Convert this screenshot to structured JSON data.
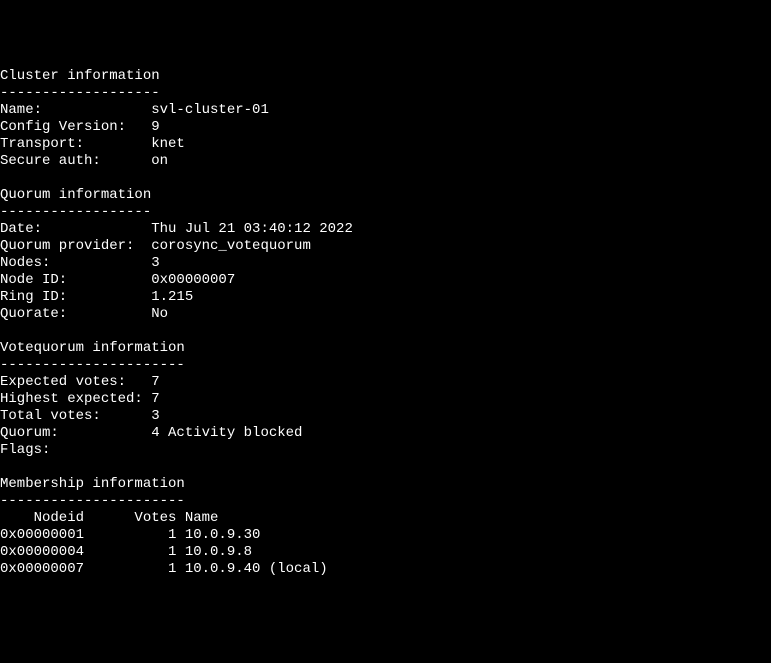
{
  "sections": {
    "cluster": {
      "title": "Cluster information",
      "underline": "-------------------",
      "rows": [
        {
          "label": "Name:",
          "value": "svl-cluster-01"
        },
        {
          "label": "Config Version:",
          "value": "9"
        },
        {
          "label": "Transport:",
          "value": "knet"
        },
        {
          "label": "Secure auth:",
          "value": "on"
        }
      ]
    },
    "quorum": {
      "title": "Quorum information",
      "underline": "------------------",
      "rows": [
        {
          "label": "Date:",
          "value": "Thu Jul 21 03:40:12 2022"
        },
        {
          "label": "Quorum provider:",
          "value": "corosync_votequorum"
        },
        {
          "label": "Nodes:",
          "value": "3"
        },
        {
          "label": "Node ID:",
          "value": "0x00000007"
        },
        {
          "label": "Ring ID:",
          "value": "1.215"
        },
        {
          "label": "Quorate:",
          "value": "No"
        }
      ]
    },
    "votequorum": {
      "title": "Votequorum information",
      "underline": "----------------------",
      "rows": [
        {
          "label": "Expected votes:",
          "value": "7"
        },
        {
          "label": "Highest expected:",
          "value": "7"
        },
        {
          "label": "Total votes:",
          "value": "3"
        },
        {
          "label": "Quorum:",
          "value": "4 Activity blocked"
        },
        {
          "label": "Flags:",
          "value": ""
        }
      ]
    },
    "membership": {
      "title": "Membership information",
      "underline": "----------------------",
      "header": "    Nodeid      Votes Name",
      "rows": [
        {
          "nodeid": "0x00000001",
          "votes": "1",
          "name": "10.0.9.30"
        },
        {
          "nodeid": "0x00000004",
          "votes": "1",
          "name": "10.0.9.8"
        },
        {
          "nodeid": "0x00000007",
          "votes": "1",
          "name": "10.0.9.40 (local)"
        }
      ]
    }
  },
  "format": {
    "label_width": 18,
    "membership_nodeid_width": 10,
    "membership_votes_width": 11
  }
}
